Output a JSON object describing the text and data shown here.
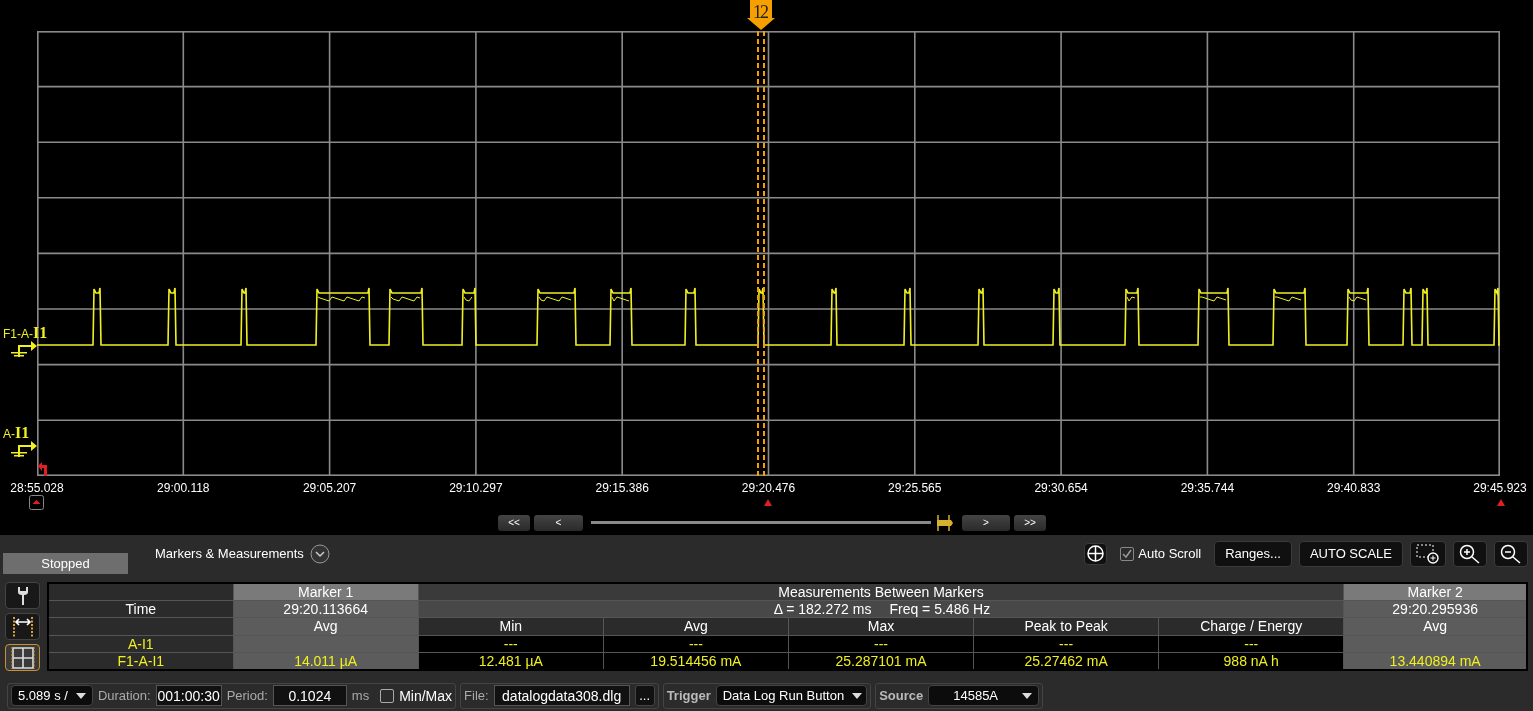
{
  "plot": {
    "markers": [
      {
        "label": "1"
      },
      {
        "label": "2"
      }
    ],
    "channels": [
      {
        "label": "F1-A-**I1**"
      },
      {
        "label": "A-**I1**"
      }
    ],
    "time_labels": [
      "28:55.028",
      "29:00.118",
      "29:05.207",
      "29:10.297",
      "29:15.386",
      "29:20.476",
      "29:25.565",
      "29:30.654",
      "29:35.744",
      "29:40.833",
      "29:45.923"
    ]
  },
  "navigation": {
    "buttons": [
      "<<",
      "<",
      ">",
      ">>"
    ]
  },
  "status": "Stopped",
  "panel_title": "Markers & Measurements",
  "toolbar": {
    "auto_scroll": {
      "label": "Auto Scroll",
      "checked": true
    },
    "buttons": [
      "Ranges...",
      "AUTO SCALE"
    ]
  },
  "tools": [
    {
      "kind": "wrench",
      "selected": false
    },
    {
      "kind": "marker",
      "selected": false
    },
    {
      "kind": "grid",
      "selected": true
    }
  ],
  "table": {
    "marker_1": "Marker 1",
    "between": "Measurements Between Markers",
    "marker_2": "Marker 2",
    "time_row": {
      "label": "Time",
      "marker_1": "29:20.113664",
      "delta": "Δ = 182.272 ms",
      "freq": "Freq = 5.486 Hz",
      "marker_2": "29:20.295936"
    },
    "columns": [
      "Avg",
      "Min",
      "Avg",
      "Max",
      "Peak to Peak",
      "Charge / Energy",
      "Avg"
    ],
    "rows": [
      {
        "label": "A-I1",
        "between": [
          "---",
          "---",
          "---",
          "---",
          "---"
        ]
      },
      {
        "label": "F1-A-I1",
        "marker_1": "14.011 µA",
        "between": [
          "12.481 µA",
          "19.514456 mA",
          "25.287101 mA",
          "25.27462 mA",
          "988 nA h"
        ],
        "marker_2": "13.440894 mA"
      }
    ]
  },
  "footer": {
    "timebase": "5.089 s /",
    "duration": {
      "label": "Duration:",
      "value": "001:00:30"
    },
    "period": {
      "label": "Period:",
      "value": "0.1024",
      "unit": "ms"
    },
    "min_max": {
      "label": "Min/Max",
      "checked": false
    },
    "file": {
      "label": "File:",
      "value": "datalogdata308.dlg",
      "browse": "..."
    },
    "trigger": {
      "label": "Trigger",
      "value": "Data Log Run Button"
    },
    "source": {
      "label": "Source",
      "value": "14585A"
    }
  }
}
